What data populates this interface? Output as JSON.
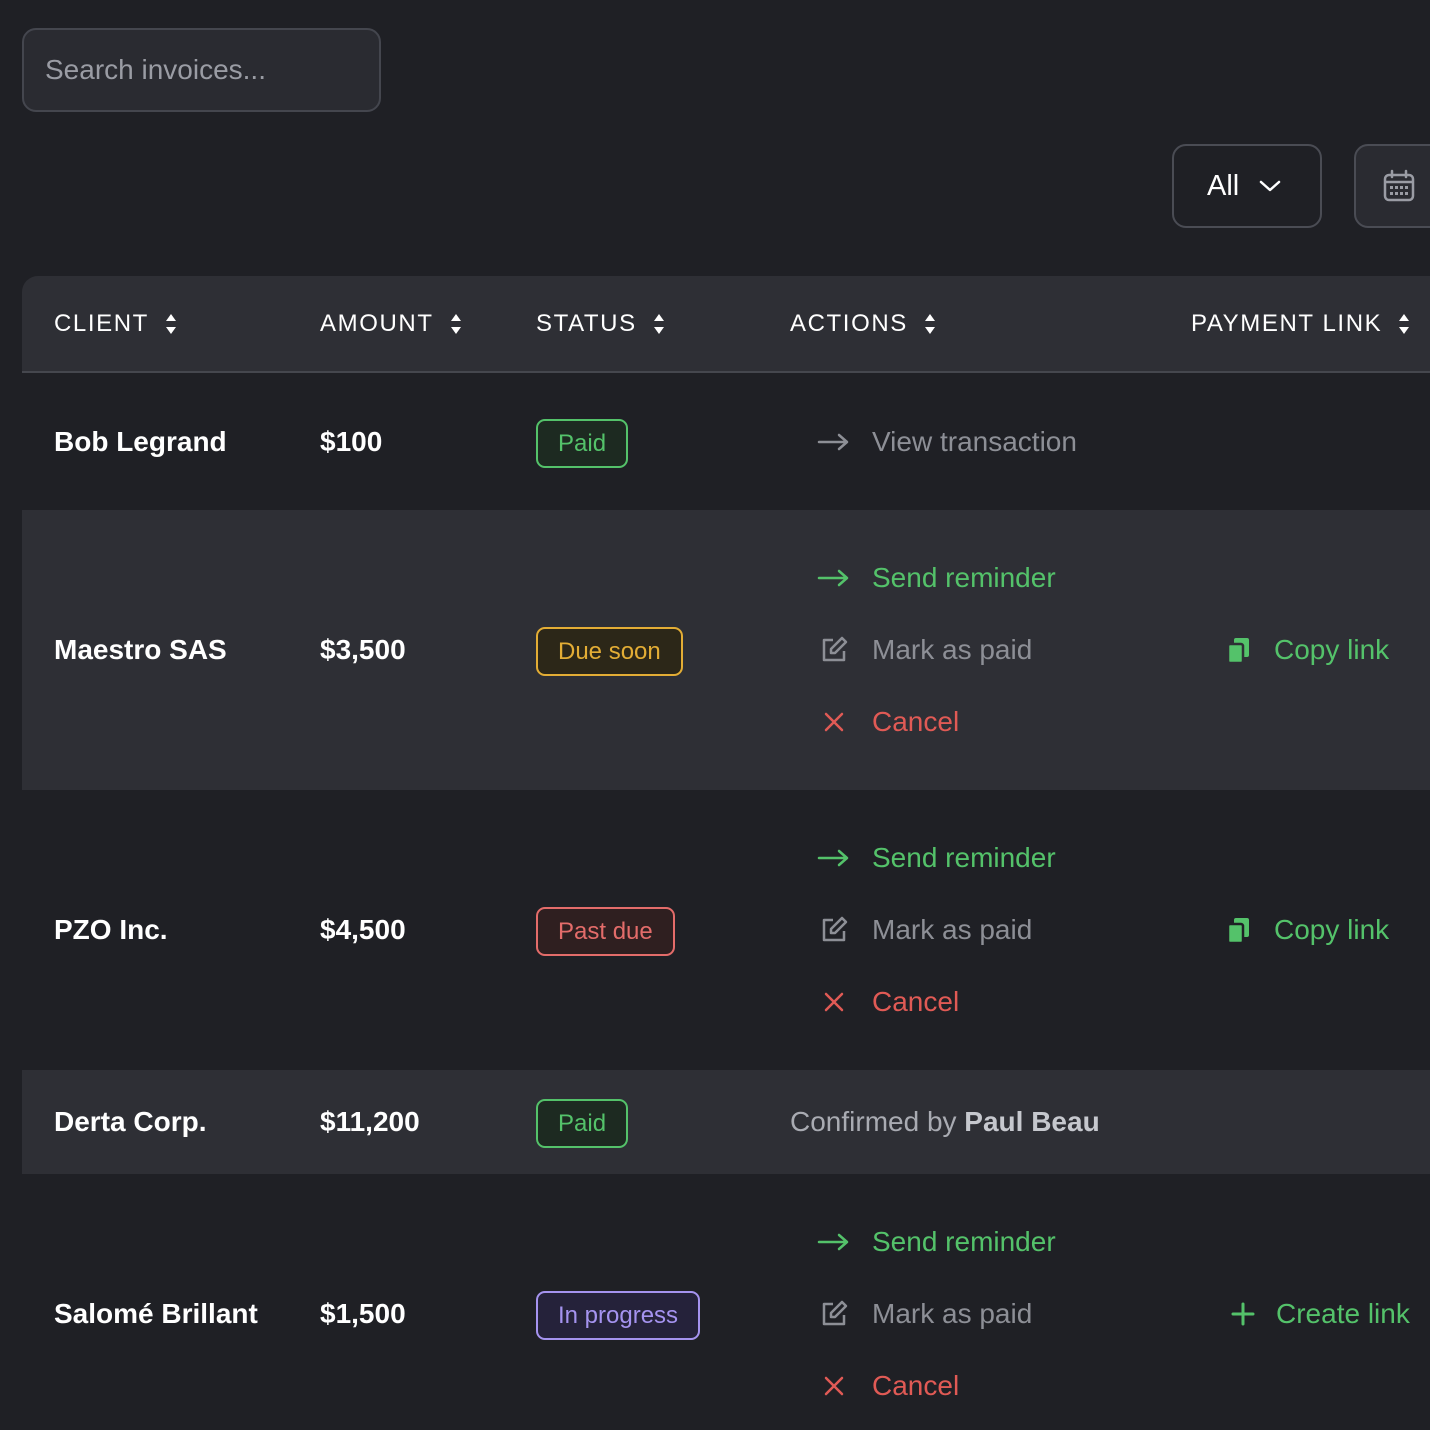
{
  "search": {
    "placeholder": "Search invoices..."
  },
  "filter": {
    "selected": "All"
  },
  "columns": [
    "CLIENT",
    "AMOUNT",
    "STATUS",
    "ACTIONS",
    "PAYMENT LINK"
  ],
  "rows": [
    {
      "client": "Bob Legrand",
      "amount": "$100",
      "status": "Paid",
      "actions": {
        "view": "View transaction"
      }
    },
    {
      "client": "Maestro SAS",
      "amount": "$3,500",
      "status": "Due soon",
      "actions": {
        "send": "Send reminder",
        "mark": "Mark as paid",
        "cancel": "Cancel"
      },
      "link": "Copy link"
    },
    {
      "client": "PZO Inc.",
      "amount": "$4,500",
      "status": "Past due",
      "actions": {
        "send": "Send reminder",
        "mark": "Mark as paid",
        "cancel": "Cancel"
      },
      "link": "Copy link"
    },
    {
      "client": "Derta Corp.",
      "amount": "$11,200",
      "status": "Paid",
      "actions": {
        "confirm_prefix": "Confirmed by",
        "confirm_name": "Paul Beau"
      }
    },
    {
      "client": "Salomé Brillant",
      "amount": "$1,500",
      "status": "In progress",
      "actions": {
        "send": "Send reminder",
        "mark": "Mark as paid",
        "cancel": "Cancel"
      },
      "link": "Create link"
    }
  ],
  "colors": {
    "background": "#1f2025",
    "header": "#2e2f35",
    "green": "#54c26a",
    "amber": "#e3ad35",
    "red": "#e05a55",
    "purple": "#a593ef",
    "muted": "#8d8f96"
  },
  "icons": [
    "search-icon",
    "chevron-down-icon",
    "calendar-icon",
    "sort-icon",
    "arrow-right-icon",
    "edit-icon",
    "close-icon",
    "copy-icon",
    "plus-icon"
  ]
}
